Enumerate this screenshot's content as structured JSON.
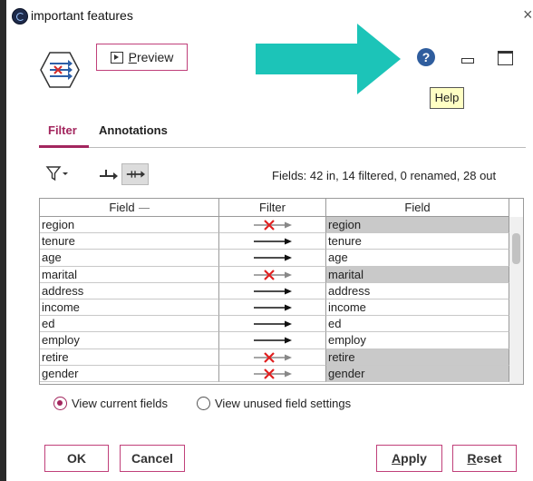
{
  "window": {
    "title": "important features"
  },
  "toolbar": {
    "preview_prefix": "P",
    "preview_rest": "review",
    "help_tooltip": "Help",
    "help_glyph": "?"
  },
  "tabs": [
    {
      "label": "Filter",
      "active": true
    },
    {
      "label": "Annotations",
      "active": false
    }
  ],
  "fields_summary": "Fields: 42 in, 14 filtered, 0 renamed, 28 out",
  "table": {
    "headers": {
      "field_in": "Field",
      "filter": "Filter",
      "field_out": "Field"
    },
    "rows": [
      {
        "field": "region",
        "filtered": true,
        "out": "region"
      },
      {
        "field": "tenure",
        "filtered": false,
        "out": "tenure"
      },
      {
        "field": "age",
        "filtered": false,
        "out": "age"
      },
      {
        "field": "marital",
        "filtered": true,
        "out": "marital"
      },
      {
        "field": "address",
        "filtered": false,
        "out": "address"
      },
      {
        "field": "income",
        "filtered": false,
        "out": "income"
      },
      {
        "field": "ed",
        "filtered": false,
        "out": "ed"
      },
      {
        "field": "employ",
        "filtered": false,
        "out": "employ"
      },
      {
        "field": "retire",
        "filtered": true,
        "out": "retire"
      },
      {
        "field": "gender",
        "filtered": true,
        "out": "gender"
      }
    ]
  },
  "view_options": {
    "current": "View current fields",
    "unused": "View unused field settings",
    "selected": "current"
  },
  "buttons": {
    "ok": "OK",
    "cancel": "Cancel",
    "apply_prefix": "A",
    "apply_rest": "pply",
    "reset_prefix": "R",
    "reset_rest": "eset"
  },
  "colors": {
    "accent": "#a3265e",
    "callout_arrow": "#1cc4b8",
    "filtered_cell": "#c9c9c9",
    "tooltip_bg": "#ffffc4"
  },
  "icons": [
    "app-logo-icon",
    "close-icon",
    "filter-node-icon",
    "play-icon",
    "help-icon",
    "minimize-icon",
    "maximize-icon",
    "funnel-icon",
    "remove-filter-icon",
    "toggle-filter-icon",
    "pass-arrow-icon",
    "filter-x-icon"
  ]
}
